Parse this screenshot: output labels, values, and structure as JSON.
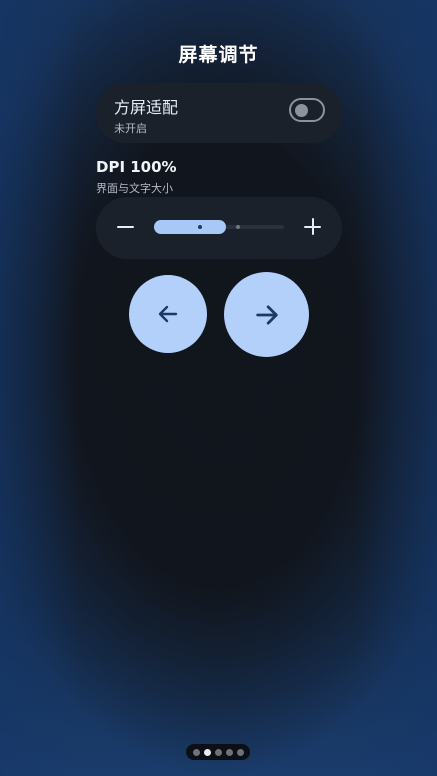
{
  "title": "屏幕调节",
  "square_fit": {
    "label": "方屏适配",
    "status": "未开启",
    "enabled": false
  },
  "dpi": {
    "label": "DPI 100%",
    "description": "界面与文字大小",
    "level_fraction": 0.55,
    "steps": 4,
    "current_step": 2
  },
  "navigation": {
    "prev_icon": "arrow-left-icon",
    "next_icon": "arrow-right-icon"
  },
  "pager": {
    "count": 5,
    "active_index": 1
  },
  "colors": {
    "accent": "#b3d0fb",
    "card": "#1b212b",
    "icon_dark": "#1c3a66"
  }
}
